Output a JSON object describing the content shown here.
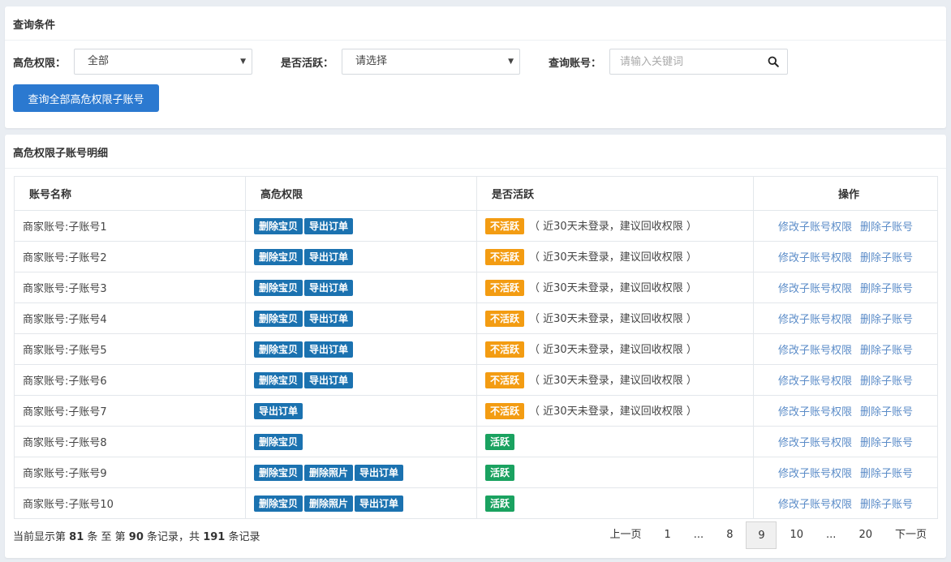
{
  "query": {
    "title": "查询条件",
    "risk_label": "高危权限：",
    "risk_value": "全部",
    "active_label": "是否活跃：",
    "active_value": "请选择",
    "account_label": "查询账号：",
    "search_placeholder": "请输入关键词",
    "search_value": "",
    "query_button": "查询全部高危权限子账号"
  },
  "list": {
    "title": "高危权限子账号明细",
    "columns": [
      "账号名称",
      "高危权限",
      "是否活跃",
      "操作"
    ],
    "rows": [
      {
        "name": "商家账号:子账号1",
        "perms": [
          "删除宝贝",
          "导出订单"
        ],
        "status": "不活跃",
        "note": "（ 近30天未登录，建议回收权限 ）"
      },
      {
        "name": "商家账号:子账号2",
        "perms": [
          "删除宝贝",
          "导出订单"
        ],
        "status": "不活跃",
        "note": "（ 近30天未登录，建议回收权限 ）"
      },
      {
        "name": "商家账号:子账号3",
        "perms": [
          "删除宝贝",
          "导出订单"
        ],
        "status": "不活跃",
        "note": "（ 近30天未登录，建议回收权限 ）"
      },
      {
        "name": "商家账号:子账号4",
        "perms": [
          "删除宝贝",
          "导出订单"
        ],
        "status": "不活跃",
        "note": "（ 近30天未登录，建议回收权限 ）"
      },
      {
        "name": "商家账号:子账号5",
        "perms": [
          "删除宝贝",
          "导出订单"
        ],
        "status": "不活跃",
        "note": "（ 近30天未登录，建议回收权限 ）"
      },
      {
        "name": "商家账号:子账号6",
        "perms": [
          "删除宝贝",
          "导出订单"
        ],
        "status": "不活跃",
        "note": "（ 近30天未登录，建议回收权限 ）"
      },
      {
        "name": "商家账号:子账号7",
        "perms": [
          "导出订单"
        ],
        "status": "不活跃",
        "note": "（ 近30天未登录，建议回收权限 ）"
      },
      {
        "name": "商家账号:子账号8",
        "perms": [
          "删除宝贝"
        ],
        "status": "活跃",
        "note": ""
      },
      {
        "name": "商家账号:子账号9",
        "perms": [
          "删除宝贝",
          "删除照片",
          "导出订单"
        ],
        "status": "活跃",
        "note": ""
      },
      {
        "name": "商家账号:子账号10",
        "perms": [
          "删除宝贝",
          "删除照片",
          "导出订单"
        ],
        "status": "活跃",
        "note": ""
      }
    ],
    "actions": {
      "edit": "修改子账号权限",
      "delete": "删除子账号"
    }
  },
  "footer": {
    "t1": "当前显示第",
    "from": "81",
    "t2": "条 至 第",
    "to": "90",
    "t3": "条记录，共",
    "total": "191",
    "t4": "条记录"
  },
  "pagination": {
    "prev": "上一页",
    "next": "下一页",
    "pages": [
      "1",
      "...",
      "8",
      "9",
      "10",
      "...",
      "20"
    ],
    "current": "9"
  },
  "colors": {
    "primary": "#2b79d0",
    "tag_blue": "#1b72b0",
    "tag_inactive": "#f39c12",
    "tag_active": "#1aa260",
    "link": "#5b8cc8"
  },
  "icons": {
    "search": "search-icon",
    "dropdown": "caret-down-icon"
  }
}
